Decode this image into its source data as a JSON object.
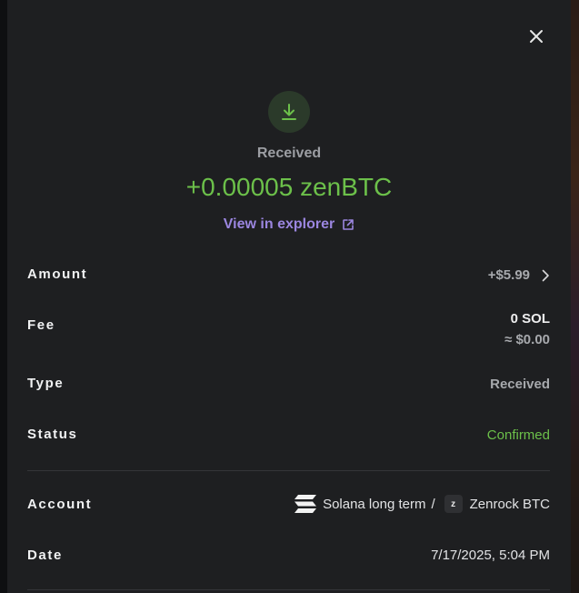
{
  "header": {
    "title": "Received",
    "amount": "+0.00005 zenBTC",
    "explorer_link": "View in explorer"
  },
  "details": {
    "amount": {
      "label": "Amount",
      "value": "+$5.99"
    },
    "fee": {
      "label": "Fee",
      "value": "0 SOL",
      "sub_value": "≈ $0.00"
    },
    "type": {
      "label": "Type",
      "value": "Received"
    },
    "status": {
      "label": "Status",
      "value": "Confirmed"
    },
    "account": {
      "label": "Account",
      "wallet": "Solana long term",
      "separator": "/",
      "token_badge": "z",
      "token": "Zenrock BTC"
    },
    "date": {
      "label": "Date",
      "value": "7/17/2025, 5:04 PM"
    }
  },
  "icons": {
    "close": "close-icon",
    "received": "download-arrow-icon",
    "external": "external-link-icon",
    "chevron": "chevron-right-icon",
    "solana": "solana-logo-icon",
    "zenrock": "zenrock-icon"
  },
  "colors": {
    "panel_bg": "#1e1f21",
    "received_green": "#6cc04a",
    "link_purple": "#9b86e0",
    "icon_circle": "#2b3a2a"
  }
}
